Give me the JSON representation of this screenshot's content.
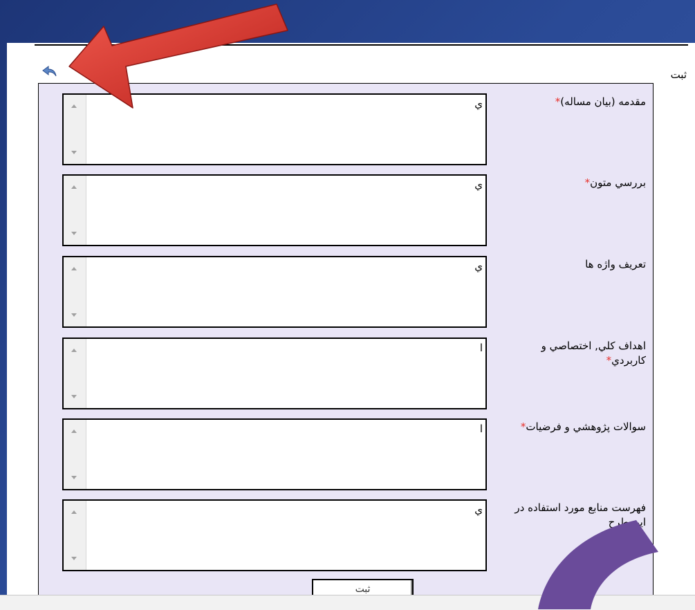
{
  "header": {
    "title": "ثبت"
  },
  "form": {
    "fields": [
      {
        "label": "مقدمه (بيان مساله)",
        "required": true,
        "value": "ي"
      },
      {
        "label": "بررسي متون",
        "required": true,
        "value": "ي"
      },
      {
        "label": "تعريف واژه ها",
        "required": false,
        "value": "ي"
      },
      {
        "label": "اهداف كلي, اختصاصي و كاربردي",
        "required": true,
        "value": "ا"
      },
      {
        "label": "سوالات پژوهشي و فرضيات",
        "required": true,
        "value": "ا"
      },
      {
        "label": "فهرست منابع مورد استفاده در اين طرح",
        "required": false,
        "value": "ي"
      }
    ],
    "required_marker": "*",
    "submit_label": "ثبت"
  },
  "icons": {
    "back": "back-arrow-icon",
    "scroll_up": "scroll-up-arrow-icon",
    "scroll_down": "scroll-down-arrow-icon"
  },
  "colors": {
    "panel_bg": "#e9e5f6",
    "required": "#e8312c",
    "annotation_arrow": "#d9302a",
    "decoration_arc": "#6a4b9a",
    "slide_bg": "#2a4a96"
  }
}
